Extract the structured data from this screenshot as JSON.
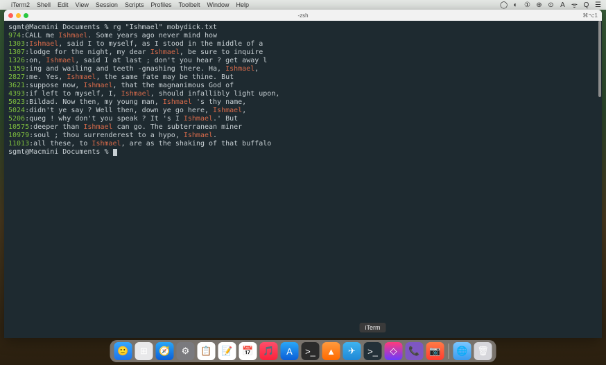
{
  "menubar": {
    "app": "iTerm2",
    "items": [
      "Shell",
      "Edit",
      "View",
      "Session",
      "Scripts",
      "Profiles",
      "Toolbelt",
      "Window",
      "Help"
    ],
    "clock": "⌘⌥1"
  },
  "window": {
    "title": "-zsh",
    "right_label": "⌘⌥1"
  },
  "terminal": {
    "prompt1_user": "sgmt@Macmini",
    "prompt1_path": "Documents",
    "prompt1_cmd": "rg \"Ishmael\" mobydick.txt",
    "lines": [
      {
        "num": "974",
        "pre": "CALL me ",
        "hl": "Ishmael",
        "post": ". Some years ago never mind how"
      },
      {
        "num": "1303",
        "pre": "",
        "hl": "Ishmael",
        "post": ", said I to myself, as I stood in the middle of a"
      },
      {
        "num": "1307",
        "pre": "lodge for the night, my dear ",
        "hl": "Ishmael",
        "post": ", be sure to inquire"
      },
      {
        "num": "1326",
        "pre": "on, ",
        "hl": "Ishmael",
        "post": ", said I at last ; don't you hear ? get away l"
      },
      {
        "num": "1359",
        "pre": "ing and wailing and teeth -gnashing there. Ha, ",
        "hl": "Ishmael",
        "post": ","
      },
      {
        "num": "2827",
        "pre": "me. Yes, ",
        "hl": "Ishmael",
        "post": ", the same fate may be thine. But"
      },
      {
        "num": "3621",
        "pre": "suppose now, ",
        "hl": "Ishmael",
        "post": ", that the magnanimous God of"
      },
      {
        "num": "4393",
        "pre": "if left to myself, I, ",
        "hl": "Ishmael",
        "post": ", should infallibly light upon,"
      },
      {
        "num": "5023",
        "pre": "Bildad. Now then, my young man, ",
        "hl": "Ishmael",
        "post": " 's thy name,"
      },
      {
        "num": "5024",
        "pre": "didn't ye say ? Well then, down ye go here, ",
        "hl": "Ishmael",
        "post": ","
      },
      {
        "num": "5206",
        "pre": "queg ! why don't you speak ? It 's I ",
        "hl": "Ishmael",
        "post": ".' But"
      },
      {
        "num": "10575",
        "pre": "deeper than ",
        "hl": "Ishmael",
        "post": " can go. The subterranean miner"
      },
      {
        "num": "10979",
        "pre": "soul ; thou surrenderest to a hypo, ",
        "hl": "Ishmael",
        "post": "."
      },
      {
        "num": "11013",
        "pre": "all these, to ",
        "hl": "Ishmael",
        "post": ", are as the shaking of that buffalo"
      }
    ],
    "prompt2_user": "sgmt@Macmini",
    "prompt2_path": "Documents"
  },
  "dock": {
    "tooltip": "iTerm",
    "icons": [
      {
        "name": "finder",
        "bg": "linear-gradient(#35a7ff,#1e73e8)",
        "glyph": "🙂"
      },
      {
        "name": "launchpad",
        "bg": "#e8e8ea",
        "glyph": "⊞"
      },
      {
        "name": "safari",
        "bg": "linear-gradient(#2aa6f7,#0b5ed7)",
        "glyph": "🧭"
      },
      {
        "name": "settings",
        "bg": "#7a7a7e",
        "glyph": "⚙"
      },
      {
        "name": "reminders",
        "bg": "#fff",
        "glyph": "📋"
      },
      {
        "name": "notes",
        "bg": "#fff",
        "glyph": "📝"
      },
      {
        "name": "calendar",
        "bg": "#fff",
        "glyph": "📅"
      },
      {
        "name": "music",
        "bg": "linear-gradient(#ff4d6a,#fa233b)",
        "glyph": "🎵"
      },
      {
        "name": "appstore",
        "bg": "linear-gradient(#2aa6f7,#0b5ed7)",
        "glyph": "A"
      },
      {
        "name": "terminal",
        "bg": "#2b2b2b",
        "glyph": ">_"
      },
      {
        "name": "vlc",
        "bg": "linear-gradient(#ff9a3d,#ff6a00)",
        "glyph": "▲"
      },
      {
        "name": "telegram",
        "bg": "linear-gradient(#3fb3f0,#1e88d6)",
        "glyph": "✈"
      },
      {
        "name": "iterm",
        "bg": "#233038",
        "glyph": ">_",
        "tooltip": true
      },
      {
        "name": "shortcuts",
        "bg": "linear-gradient(#ff3b7b,#6a3bff)",
        "glyph": "◇"
      },
      {
        "name": "viber",
        "bg": "#7e57c2",
        "glyph": "📞"
      },
      {
        "name": "photobooth",
        "bg": "linear-gradient(#ff7a45,#ff3b30)",
        "glyph": "📷"
      },
      {
        "name": "separator"
      },
      {
        "name": "folder",
        "bg": "linear-gradient(#7ac6ff,#3a9bef)",
        "glyph": "🌐"
      },
      {
        "name": "trash",
        "bg": "#d6d6db",
        "glyph": "🗑"
      }
    ]
  }
}
